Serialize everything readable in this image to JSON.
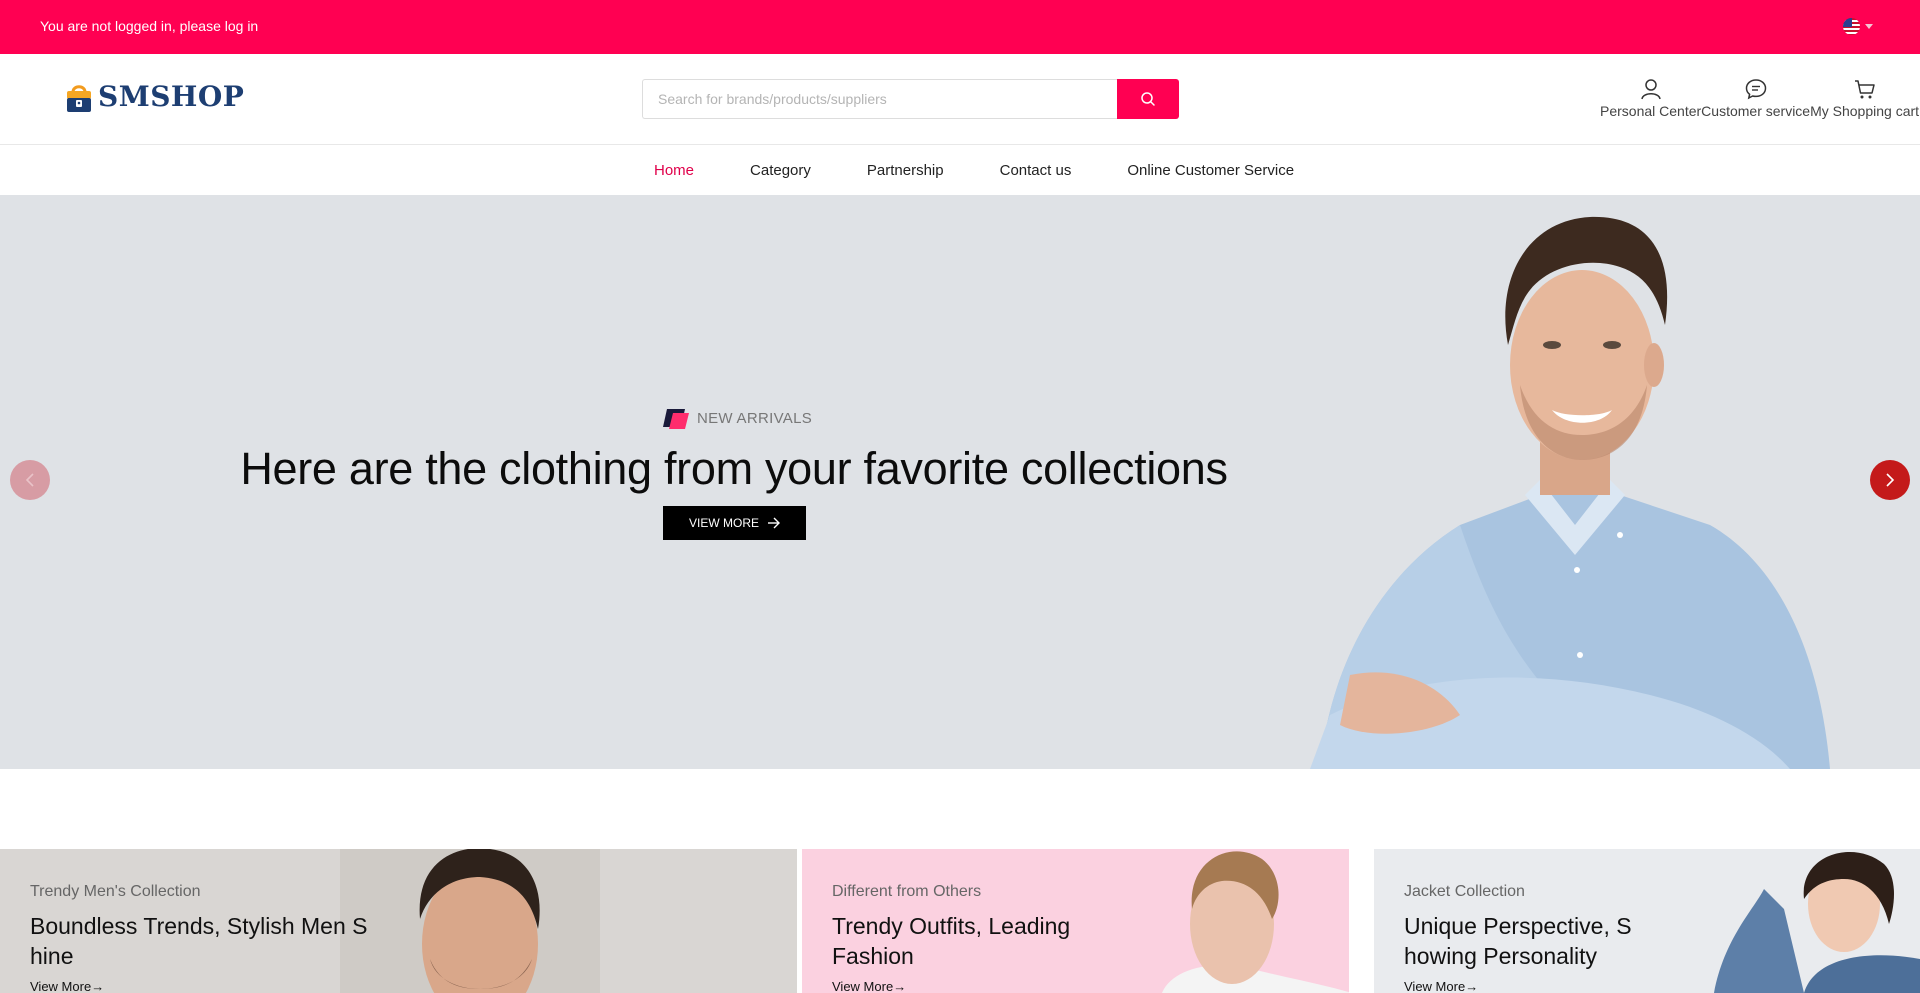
{
  "topbar": {
    "login_text": "You are not logged in, please log in",
    "language_icon": "us-flag-icon",
    "bg_color": "#ff0052"
  },
  "header": {
    "logo_text": "SMSHOP",
    "search_placeholder": "Search for brands/products/suppliers",
    "links": [
      {
        "label": "Personal Center",
        "icon": "user-icon"
      },
      {
        "label": "Customer service",
        "icon": "chat-icon"
      },
      {
        "label": "My Shopping cart",
        "icon": "cart-icon"
      }
    ]
  },
  "nav": {
    "items": [
      {
        "label": "Home",
        "active": true
      },
      {
        "label": "Category"
      },
      {
        "label": "Partnership"
      },
      {
        "label": "Contact us"
      },
      {
        "label": "Online Customer Service"
      }
    ]
  },
  "hero": {
    "tag": "NEW ARRIVALS",
    "title": "Here are the clothing from your favorite collections",
    "button_label": "VIEW MORE",
    "prev_icon": "chevron-left-icon",
    "next_icon": "chevron-right-icon"
  },
  "cards": [
    {
      "subtitle": "Trendy Men's Collection",
      "title": "Boundless Trends, Stylish Men S hine",
      "link": "View More"
    },
    {
      "subtitle": "Different from Others",
      "title": "Trendy Outfits, Leading Fashion",
      "link": "View More"
    },
    {
      "subtitle": "Jacket Collection",
      "title": "Unique Perspective, S howing Personality",
      "link": "View More"
    }
  ],
  "colors": {
    "accent": "#ff0052",
    "brand": "#1d3e72",
    "nav_active": "#e0004a"
  }
}
